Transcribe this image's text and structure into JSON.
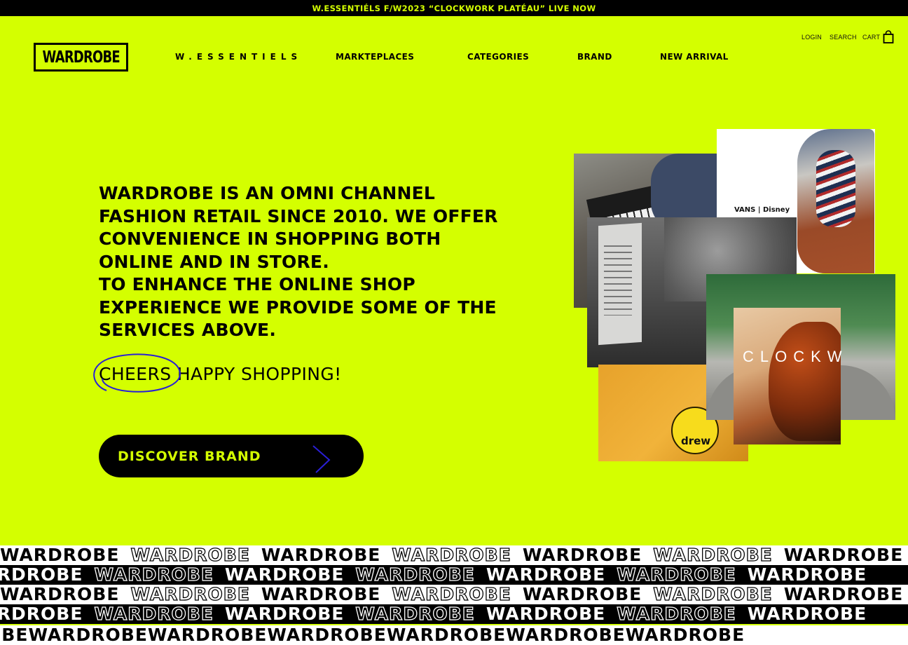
{
  "announcement": "W.ESSENTIÉLS F/W2023 “CLOCKWORK PLATÉAU” LIVE NOW",
  "logo": {
    "text": "WARDROBE"
  },
  "nav": {
    "essentiels": "W.ESSENTIELS",
    "marketplaces": "MARKTEPLACES",
    "categories": "CATEGORIES",
    "brand": "BRAND",
    "new_arrival": "NEW ARRIVAL"
  },
  "utility": {
    "login": "LOGIN",
    "search": "SEARCH",
    "cart": "CART",
    "cart_icon": "shopping-bag-icon"
  },
  "hero": {
    "headline_lines": [
      "WARDROBE IS AN OMNI CHANNEL",
      "FASHION RETAIL SINCE 2010. WE OFFER",
      "CONVENIENCE IN SHOPPING BOTH",
      "ONLINE AND IN STORE.",
      "TO ENHANCE THE ONLINE SHOP",
      "EXPERIENCE WE PROVIDE SOME OF THE",
      "SERVICES ABOVE."
    ],
    "cheers": "CHEERS HAPPY SHOPPING!",
    "cta_label": "DISCOVER BRAND",
    "cta_icon": "chevron-right-icon"
  },
  "collage": {
    "vans_logo": "VANS | Disney",
    "clockwork_text": "CLOCKW",
    "drew_text": "drew"
  },
  "ticker": {
    "word": "WARDROBE"
  },
  "colors": {
    "accent": "#d4ff00",
    "ink": "#000000",
    "scribble": "#2a1fd6"
  }
}
